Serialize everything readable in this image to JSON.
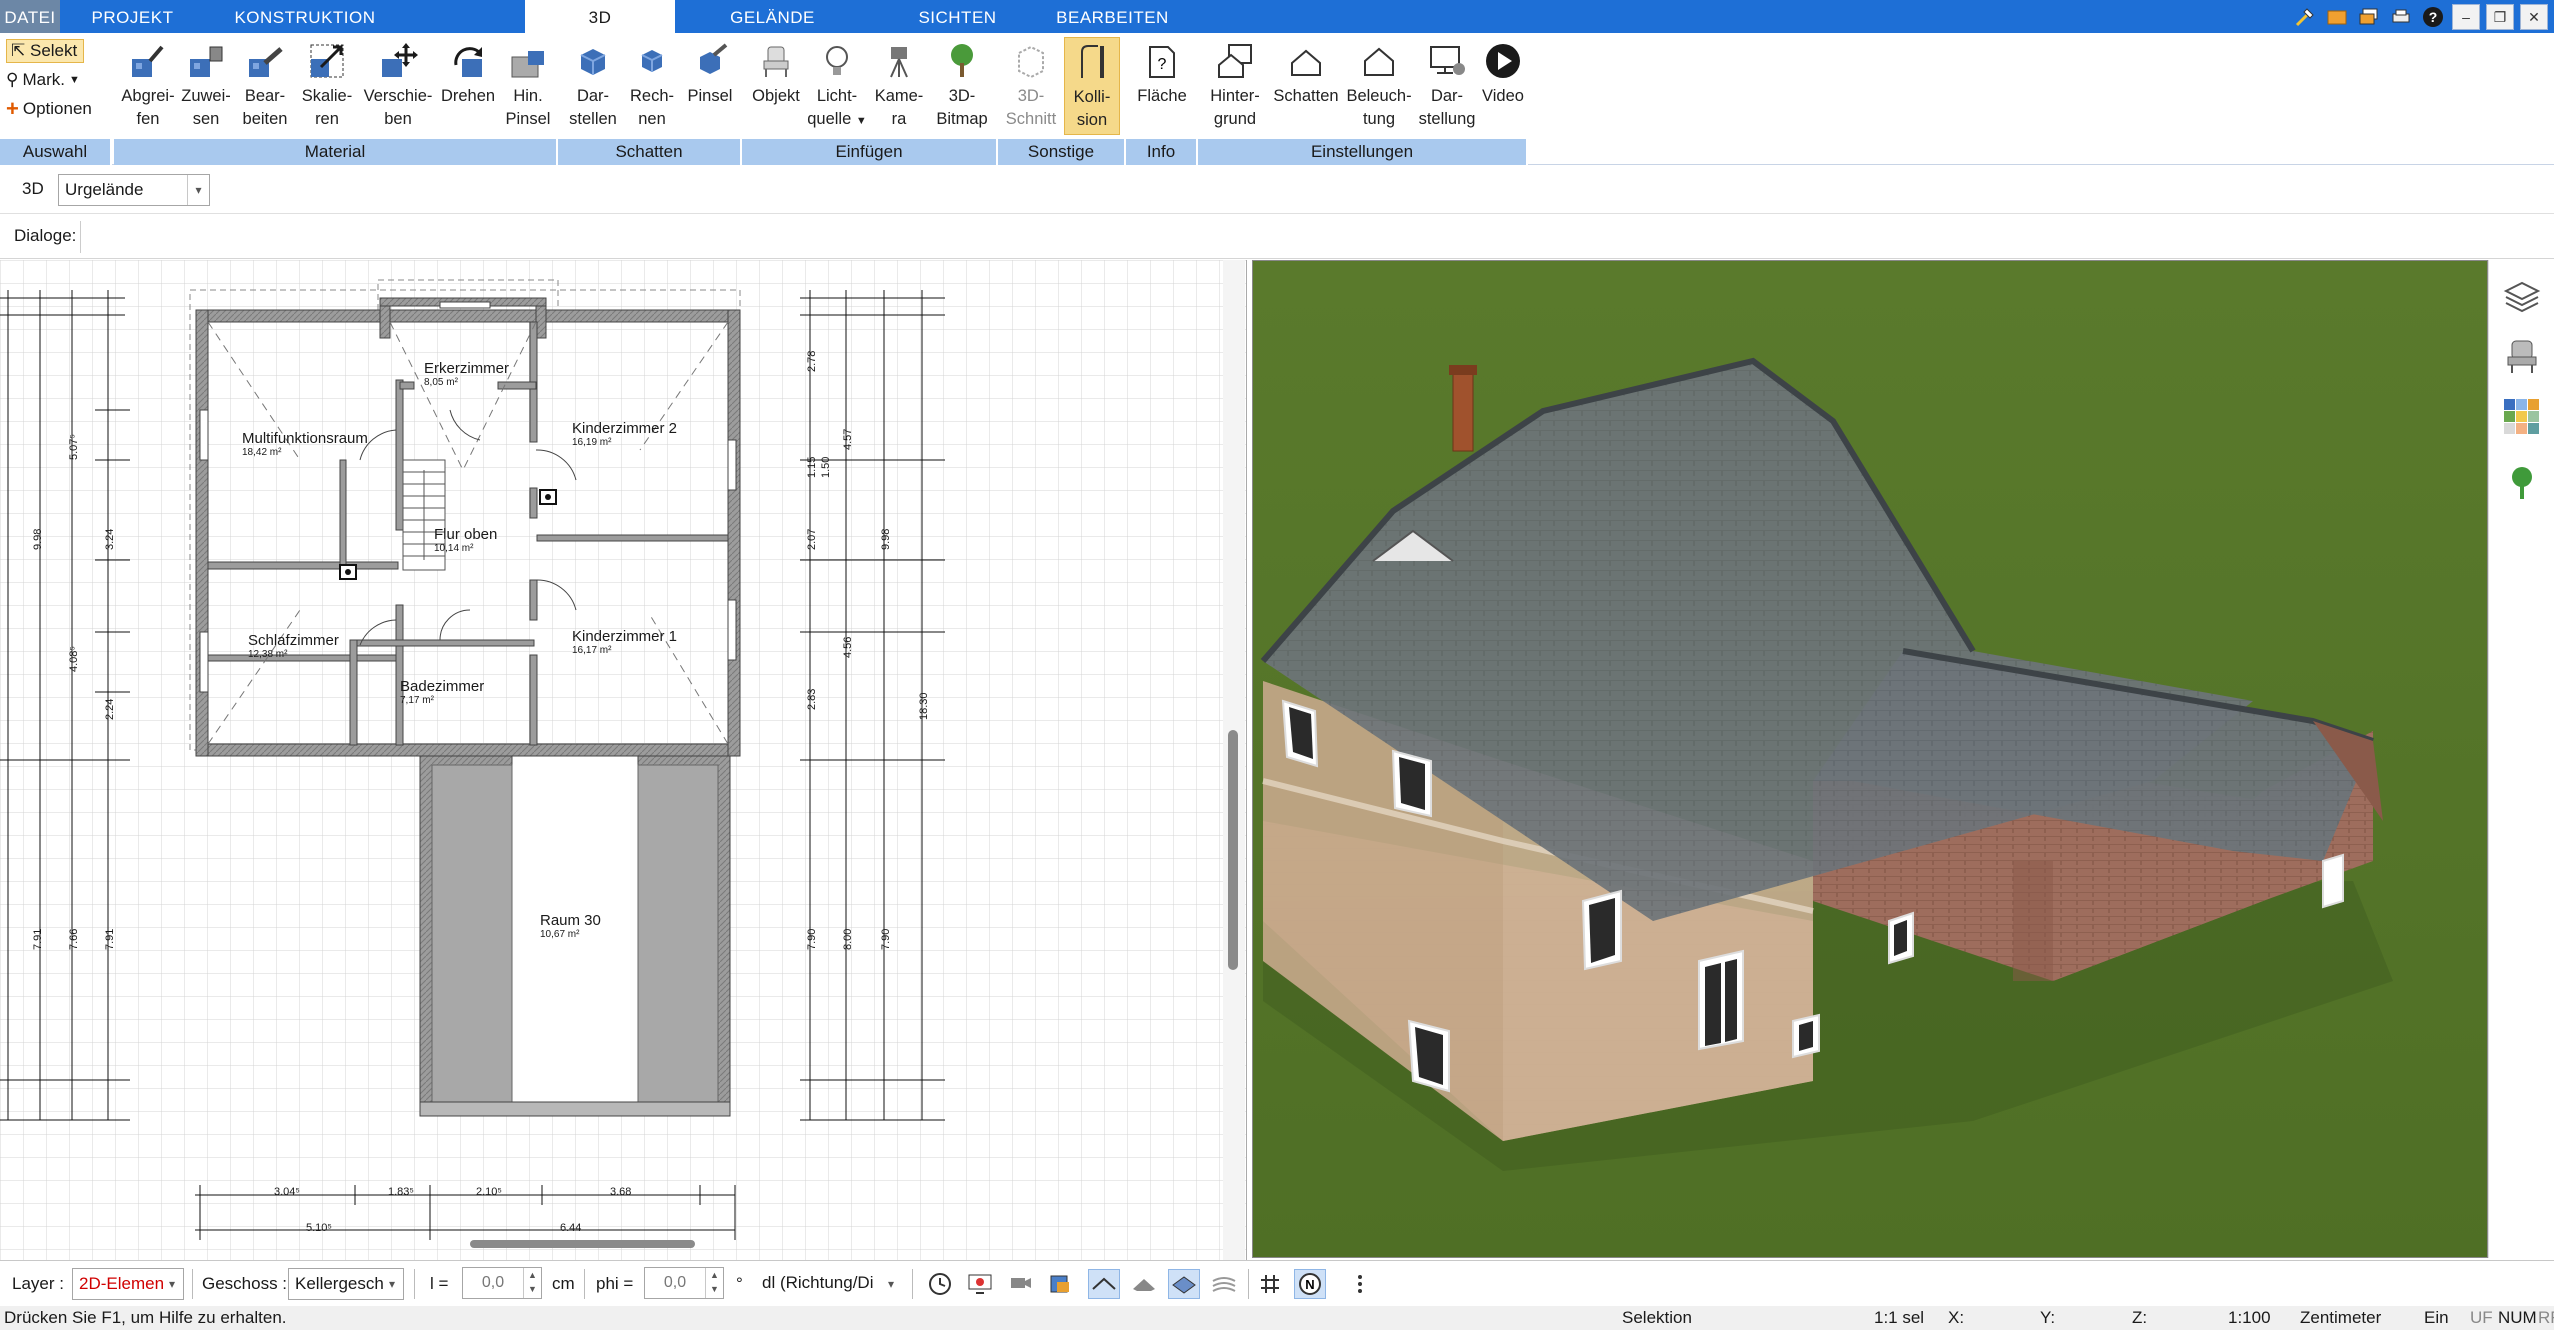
{
  "tabs": [
    {
      "label": "DATEI"
    },
    {
      "label": "PROJEKT"
    },
    {
      "label": "KONSTRUKTION"
    },
    {
      "label": "3D"
    },
    {
      "label": "GELÄNDE"
    },
    {
      "label": "SICHTEN"
    },
    {
      "label": "BEARBEITEN"
    }
  ],
  "ribbon": {
    "auswahl": {
      "label": "Auswahl",
      "selekt": "Selekt",
      "mark": "Mark.",
      "optionen": "Optionen"
    },
    "material": {
      "label": "Material",
      "buttons": [
        {
          "line1": "Abgrei-",
          "line2": "fen"
        },
        {
          "line1": "Zuwei-",
          "line2": "sen"
        },
        {
          "line1": "Bear-",
          "line2": "beiten"
        },
        {
          "line1": "Skalie-",
          "line2": "ren"
        },
        {
          "line1": "Verschie-",
          "line2": "ben"
        },
        {
          "line1": "Drehen",
          "line2": ""
        },
        {
          "line1": "Hin.",
          "line2": "Pinsel"
        }
      ]
    },
    "schatten": {
      "label": "Schatten",
      "buttons": [
        {
          "line1": "Dar-",
          "line2": "stellen"
        },
        {
          "line1": "Rech-",
          "line2": "nen"
        },
        {
          "line1": "Pinsel",
          "line2": ""
        }
      ]
    },
    "einfuegen": {
      "label": "Einfügen",
      "buttons": [
        {
          "line1": "Objekt",
          "line2": ""
        },
        {
          "line1": "Licht-",
          "line2": "quelle"
        },
        {
          "line1": "Kame-",
          "line2": "ra"
        },
        {
          "line1": "3D-",
          "line2": "Bitmap"
        }
      ]
    },
    "sonstige": {
      "label": "Sonstige",
      "buttons": [
        {
          "line1": "3D-",
          "line2": "Schnitt"
        },
        {
          "line1": "Kolli-",
          "line2": "sion"
        }
      ]
    },
    "info": {
      "label": "Info",
      "buttons": [
        {
          "line1": "Fläche",
          "line2": ""
        }
      ]
    },
    "einstellungen": {
      "label": "Einstellungen",
      "buttons": [
        {
          "line1": "Hinter-",
          "line2": "grund"
        },
        {
          "line1": "Schatten",
          "line2": ""
        },
        {
          "line1": "Beleuch-",
          "line2": "tung"
        },
        {
          "line1": "Dar-",
          "line2": "stellung"
        },
        {
          "line1": "Video",
          "line2": ""
        }
      ]
    }
  },
  "toolbar3d": {
    "label": "3D",
    "combo_value": "Urgelände"
  },
  "dialoge": {
    "label": "Dialoge:"
  },
  "plan": {
    "rooms": [
      {
        "name": "Erkerzimmer",
        "area": "8,05 m²"
      },
      {
        "name": "Multifunktionsraum",
        "area": "18,42 m²"
      },
      {
        "name": "Kinderzimmer 2",
        "area": "16,19 m²"
      },
      {
        "name": "Flur oben",
        "area": "10,14 m²"
      },
      {
        "name": "Schlafzimmer",
        "area": "12,38 m²"
      },
      {
        "name": "Kinderzimmer 1",
        "area": "16,17 m²"
      },
      {
        "name": "Badezimmer",
        "area": "7,17 m²"
      },
      {
        "name": "Raum 30",
        "area": "10,67 m²"
      }
    ],
    "dims_bottom": [
      "3.04⁵",
      "1.83⁵",
      "2.10⁵",
      "3.68",
      "6.44",
      "5.10⁵"
    ],
    "dims_right": [
      "2.78",
      "4.57",
      "1.15",
      "1.50",
      "2.07",
      "4.56",
      "2.83",
      "7.90",
      "8.00",
      "7.90",
      "9.98",
      "18.30"
    ],
    "dims_left": [
      "5.07⁵",
      "9.98",
      "3.24",
      "4.08⁵",
      "2.24",
      "7.91",
      "7.66",
      "7.91"
    ]
  },
  "bottombar": {
    "layer_label": "Layer :",
    "layer_value": "2D-Elemen",
    "geschoss_label": "Geschoss :",
    "geschoss_value": "Kellergesch",
    "l_label": "l =",
    "l_value": "0,0",
    "l_unit": "cm",
    "phi_label": "phi =",
    "phi_value": "0,0",
    "phi_unit": "°",
    "dl_value": "dl (Richtung/Di"
  },
  "status": {
    "help": "Drücken Sie F1, um Hilfe zu erhalten.",
    "mode": "Selektion",
    "scale_sel": "1:1 sel",
    "x": "X:",
    "y": "Y:",
    "z": "Z:",
    "scale": "1:100",
    "unit": "Zentimeter",
    "ein": "Ein",
    "uf": "UF",
    "num": "NUM",
    "rf": "RF"
  },
  "colors": {
    "accent": "#1e6fd6",
    "group_bg": "#a9c9ee",
    "active_btn": "#f5d98a",
    "grass": "#5a7a2e",
    "roof": "#6c7378",
    "brick": "#9a6a5a"
  }
}
